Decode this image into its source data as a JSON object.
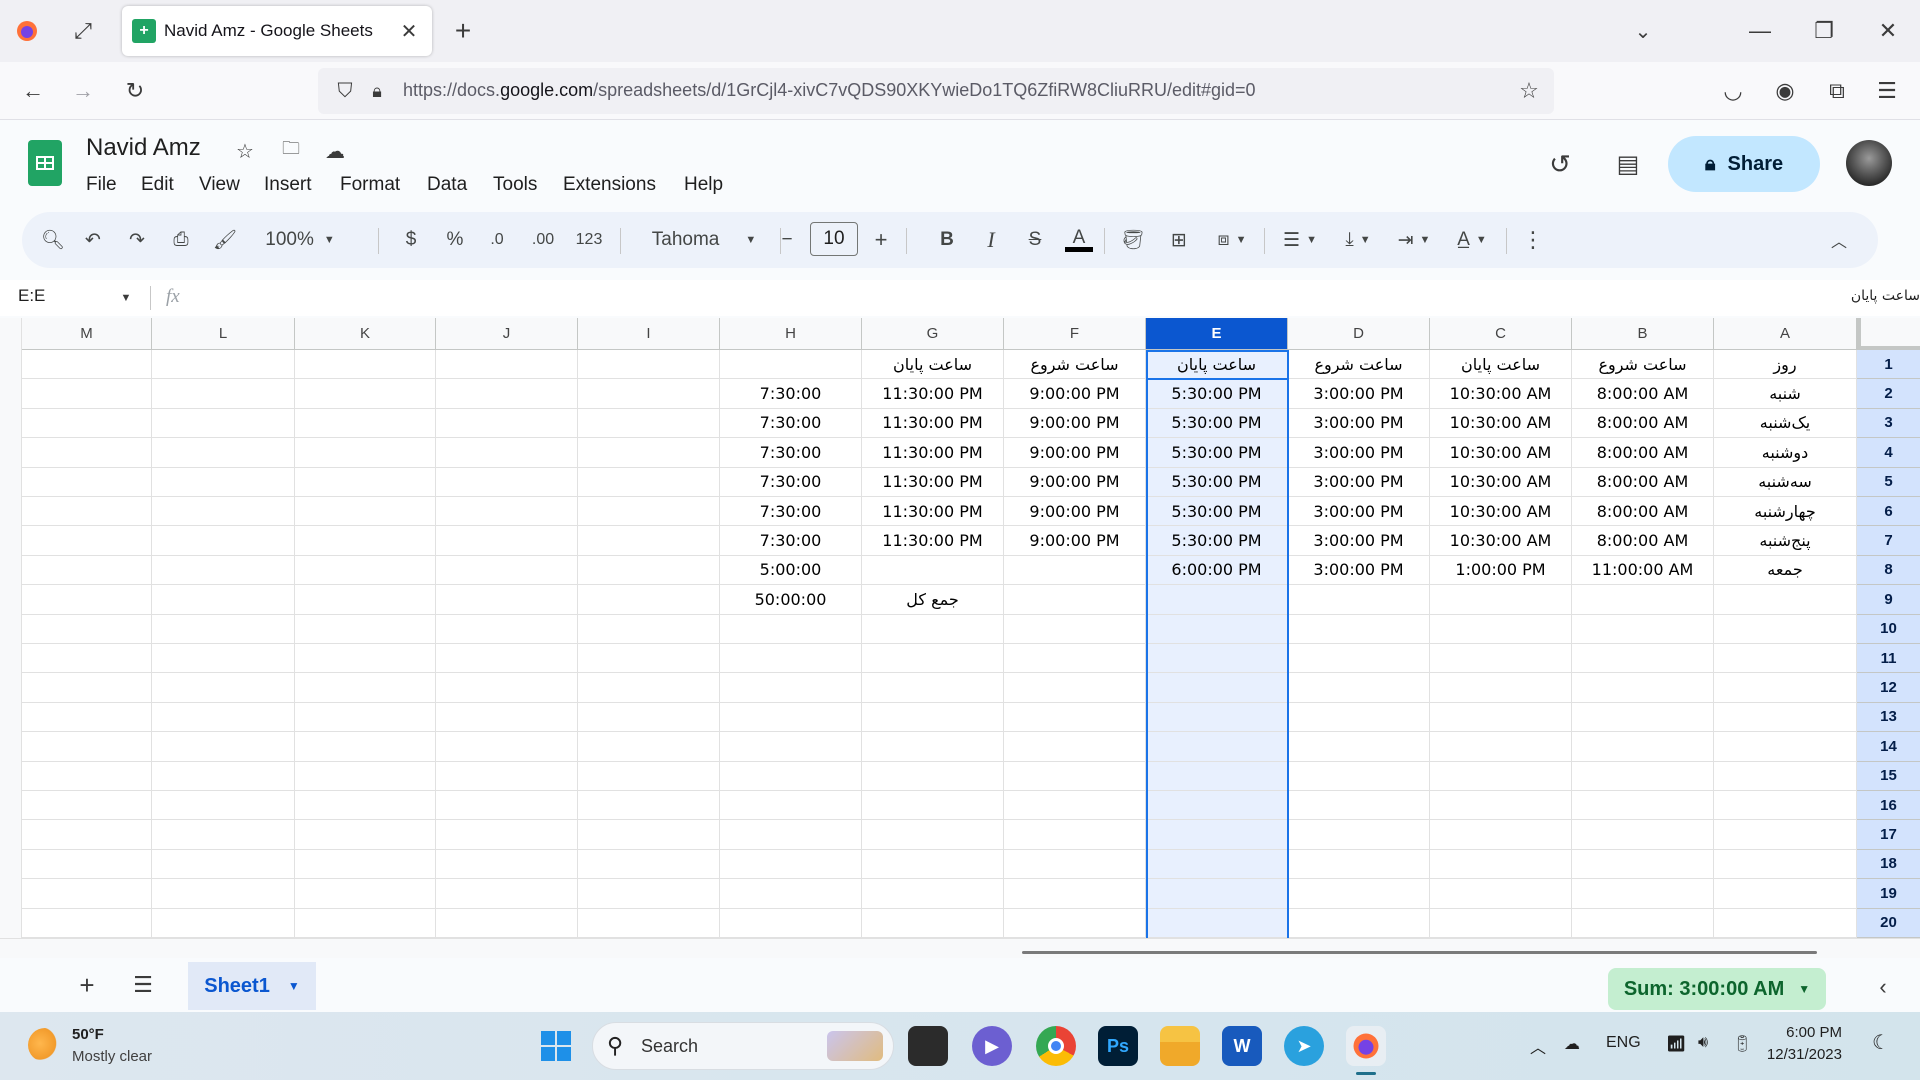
{
  "browser": {
    "tab_title": "Navid Amz - Google Sheets",
    "new_tab": "+",
    "url_prefix": "https://docs.",
    "url_domain": "google.com",
    "url_path": "/spreadsheets/d/1GrCjl4-xivC7vQDS90XKYwieDo1TQ6ZfiRW8CliuRRU/edit#gid=0"
  },
  "app": {
    "doc_title": "Navid Amz",
    "menus": [
      "File",
      "Edit",
      "View",
      "Insert",
      "Format",
      "Data",
      "Tools",
      "Extensions",
      "Help"
    ],
    "share_label": "Share",
    "accent": "#0b57d0"
  },
  "toolbar": {
    "zoom": "100%",
    "currency": "$",
    "percent": "%",
    "dec_decrease": ".0",
    "dec_increase": ".00",
    "more_formats": "123",
    "font": "Tahoma",
    "font_size": "10",
    "bold": "B",
    "italic": "I",
    "text_color": "A"
  },
  "formula_bar": {
    "name_box": "E:E",
    "fx": "fx",
    "content": "ساعت پایان"
  },
  "grid": {
    "columns": [
      "M",
      "L",
      "K",
      "J",
      "I",
      "H",
      "G",
      "F",
      "E",
      "D",
      "C",
      "B",
      "A"
    ],
    "selected_column": "E",
    "row_numbers": [
      "1",
      "2",
      "3",
      "4",
      "5",
      "6",
      "7",
      "8",
      "9",
      "10",
      "11",
      "12",
      "13",
      "14",
      "15",
      "16",
      "17",
      "18",
      "19",
      "20"
    ],
    "rows": [
      {
        "A": "روز",
        "B": "ساعت شروع",
        "C": "ساعت پایان",
        "D": "ساعت شروع",
        "E": "ساعت پایان",
        "F": "ساعت شروع",
        "G": "ساعت پایان",
        "H": ""
      },
      {
        "A": "شنبه",
        "B": "8:00:00 AM",
        "C": "10:30:00 AM",
        "D": "3:00:00 PM",
        "E": "5:30:00 PM",
        "F": "9:00:00 PM",
        "G": "11:30:00 PM",
        "H": "7:30:00"
      },
      {
        "A": "یک‌شنبه",
        "B": "8:00:00 AM",
        "C": "10:30:00 AM",
        "D": "3:00:00 PM",
        "E": "5:30:00 PM",
        "F": "9:00:00 PM",
        "G": "11:30:00 PM",
        "H": "7:30:00"
      },
      {
        "A": "دوشنبه",
        "B": "8:00:00 AM",
        "C": "10:30:00 AM",
        "D": "3:00:00 PM",
        "E": "5:30:00 PM",
        "F": "9:00:00 PM",
        "G": "11:30:00 PM",
        "H": "7:30:00"
      },
      {
        "A": "سه‌شنبه",
        "B": "8:00:00 AM",
        "C": "10:30:00 AM",
        "D": "3:00:00 PM",
        "E": "5:30:00 PM",
        "F": "9:00:00 PM",
        "G": "11:30:00 PM",
        "H": "7:30:00"
      },
      {
        "A": "چهارشنبه",
        "B": "8:00:00 AM",
        "C": "10:30:00 AM",
        "D": "3:00:00 PM",
        "E": "5:30:00 PM",
        "F": "9:00:00 PM",
        "G": "11:30:00 PM",
        "H": "7:30:00"
      },
      {
        "A": "پنج‌شنبه",
        "B": "8:00:00 AM",
        "C": "10:30:00 AM",
        "D": "3:00:00 PM",
        "E": "5:30:00 PM",
        "F": "9:00:00 PM",
        "G": "11:30:00 PM",
        "H": "7:30:00"
      },
      {
        "A": "جمعه",
        "B": "11:00:00 AM",
        "C": "1:00:00 PM",
        "D": "3:00:00 PM",
        "E": "6:00:00 PM",
        "F": "",
        "G": "",
        "H": "5:00:00"
      },
      {
        "A": "",
        "B": "",
        "C": "",
        "D": "",
        "E": "",
        "F": "",
        "G": "جمع کل",
        "H": "50:00:00"
      }
    ]
  },
  "sheets": {
    "add": "+",
    "active_sheet": "Sheet1",
    "sum_label": "Sum: 3:00:00 AM"
  },
  "taskbar": {
    "weather_temp": "50°F",
    "weather_desc": "Mostly clear",
    "search_placeholder": "Search",
    "language": "ENG",
    "time": "6:00 PM",
    "date": "12/31/2023"
  }
}
